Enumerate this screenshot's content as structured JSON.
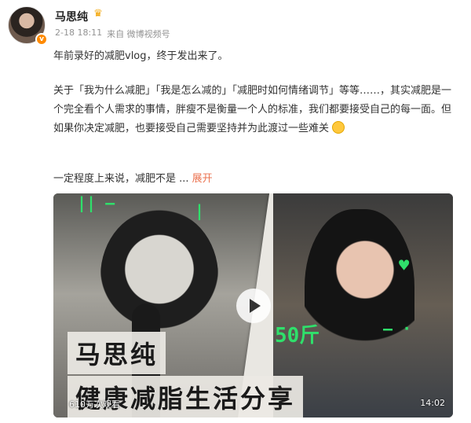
{
  "post": {
    "author": {
      "name": "马思纯",
      "badge_icon": "crown-icon",
      "verified_mark": "v",
      "avatar": "avatar-icon"
    },
    "meta": {
      "time": "2-18 18:11",
      "source": "来自 微博视频号"
    },
    "text": {
      "line1": "年前录好的减肥vlog，终于发出来了。",
      "para2": "关于「我为什么减肥」「我是怎么减的」「减肥时如何情绪调节」等等……，其实减肥是一个完全看个人需求的事情，胖瘦不是衡量一个人的标准，我们都要接受自己的每一面。但如果你决定减肥，也要接受自己需要坚持并为此渡过一些难关",
      "para3_prefix": "一定程度上来说，减肥不是 ...",
      "expand_label": "展开"
    },
    "video": {
      "title_line1": "马思纯",
      "title_line2": "健康减脂生活分享",
      "doodle_text": "50斤",
      "views": "610万次观看",
      "duration": "14:02",
      "accent_color": "#2fe06b"
    }
  }
}
